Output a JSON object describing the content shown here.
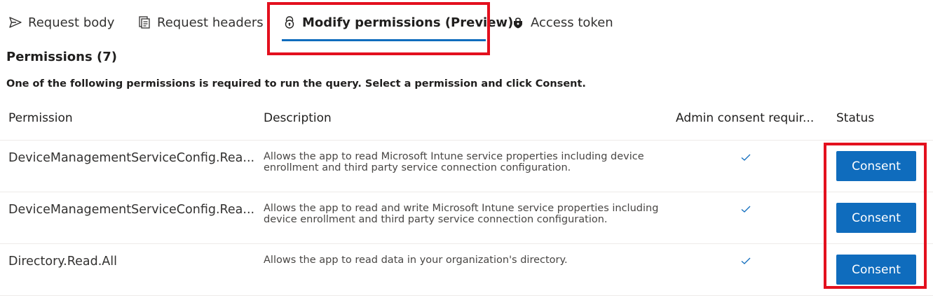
{
  "tabs": [
    {
      "label": "Request body",
      "icon": "send-icon",
      "active": false
    },
    {
      "label": "Request headers",
      "icon": "document-list-icon",
      "active": false
    },
    {
      "label": "Modify permissions (Preview)",
      "icon": "shield-lock-icon",
      "active": true
    },
    {
      "label": "Access token",
      "icon": "lock-shield-icon",
      "active": false
    }
  ],
  "section": {
    "title": "Permissions (7)",
    "instruction": "One of the following permissions is required to run the query. Select a permission and click Consent."
  },
  "table": {
    "columns": [
      "Permission",
      "Description",
      "Admin consent requir...",
      "Status"
    ],
    "rows": [
      {
        "permission": "DeviceManagementServiceConfig.Rea...",
        "description": "Allows the app to read Microsoft Intune service properties including device enrollment and third party service connection configuration.",
        "admin_consent_required": true,
        "status_button": "Consent"
      },
      {
        "permission": "DeviceManagementServiceConfig.Rea...",
        "description": "Allows the app to read and write Microsoft Intune service properties including device enrollment and third party service connection configuration.",
        "admin_consent_required": true,
        "status_button": "Consent"
      },
      {
        "permission": "Directory.Read.All",
        "description": "Allows the app to read data in your organization's directory.",
        "admin_consent_required": true,
        "status_button": "Consent"
      }
    ]
  },
  "colors": {
    "accent": "#0f6cbd",
    "highlight": "#e3101e",
    "check": "#0f6cbd"
  }
}
